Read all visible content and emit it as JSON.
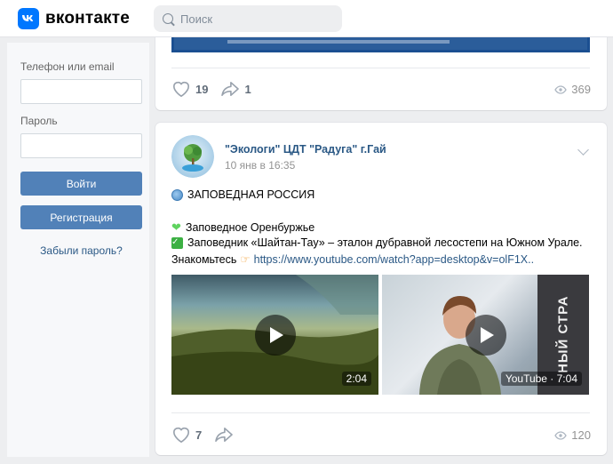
{
  "header": {
    "logo_letter": "vk",
    "logo_text": "вконтакте",
    "search_placeholder": "Поиск"
  },
  "login": {
    "phone_label": "Телефон или email",
    "password_label": "Пароль",
    "login_button": "Войти",
    "register_button": "Регистрация",
    "forgot_link": "Забыли пароль?"
  },
  "post1": {
    "likes": "19",
    "shares": "1",
    "views": "369"
  },
  "post2": {
    "author": "\"Экологи\" ЦДТ \"Радуга\" г.Гай",
    "date": "10 янв в 16:35",
    "line1": "ЗАПОВЕДНАЯ РОССИЯ",
    "line2": "Заповедное Оренбуржье",
    "line3": "Заповедник «Шайтан-Тау» – эталон дубравной лесостепи на Южном Урале.",
    "line4_text": "Знакомьтесь",
    "line4_link": "https://www.youtube.com/watch?app=desktop&v=olF1X..",
    "video1_duration": "2:04",
    "video2_duration": "YouTube · 7:04",
    "video2_banner": "НЫЙ СТРА",
    "likes": "7",
    "views": "120"
  },
  "colors": {
    "accent": "#0077ff",
    "button": "#5181b8",
    "link": "#2a5885"
  }
}
